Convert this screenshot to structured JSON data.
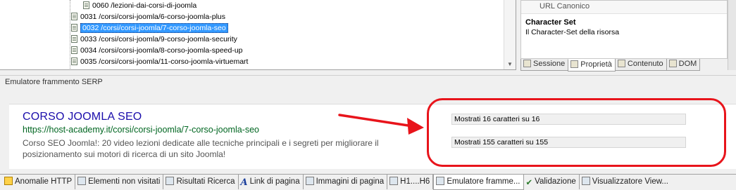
{
  "tree": {
    "rows": [
      {
        "label": "0060 /lezioni-dai-corsi-di-joomla",
        "selected": false
      },
      {
        "label": "0031 /corsi/corsi-joomla/6-corso-joomla-plus",
        "selected": false
      },
      {
        "label": "0032 /corsi/corsi-joomla/7-corso-joomla-seo",
        "selected": true
      },
      {
        "label": "0033 /corsi/corsi-joomla/9-corso-joomla-security",
        "selected": false
      },
      {
        "label": "0034 /corsi/corsi-joomla/8-corso-joomla-speed-up",
        "selected": false
      },
      {
        "label": "0035 /corsi/corsi-joomla/11-corso-joomla-virtuemart",
        "selected": false
      }
    ]
  },
  "properties": {
    "top_row": "URL Canonico",
    "title": "Character Set",
    "description": "Il Character-Set della risorsa",
    "tabs": [
      {
        "label": "Sessione",
        "active": false,
        "icon": "session-icon"
      },
      {
        "label": "Proprietà",
        "active": true,
        "icon": "properties-icon"
      },
      {
        "label": "Contenuto",
        "active": false,
        "icon": "content-icon"
      },
      {
        "label": "DOM",
        "active": false,
        "icon": "dom-icon"
      }
    ]
  },
  "serp": {
    "header": "Emulatore frammento SERP",
    "title": "CORSO JOOMLA SEO",
    "url": "https://host-academy.it/corsi/corsi-joomla/7-corso-joomla-seo",
    "description": "Corso SEO Joomla!: 20 video lezioni dedicate alle tecniche principali e i segreti per migliorare il posizionamento sui motori di ricerca di un sito Joomla!",
    "title_counter": "Mostrati 16 caratteri su 16",
    "desc_counter": "Mostrati 155 caratteri su 155"
  },
  "bottom_tabs": [
    {
      "label": "Anomalie HTTP",
      "icon": "warning-icon",
      "active": false
    },
    {
      "label": "Elementi non visitati",
      "icon": "unvisited-icon",
      "active": false
    },
    {
      "label": "Risultati Ricerca",
      "icon": "search-results-icon",
      "active": false
    },
    {
      "label": "Link di pagina",
      "icon": "link-icon",
      "active": false
    },
    {
      "label": "Immagini di pagina",
      "icon": "images-icon",
      "active": false
    },
    {
      "label": "H1....H6",
      "icon": "headings-icon",
      "active": false
    },
    {
      "label": "Emulatore framme...",
      "icon": "serp-emulator-icon",
      "active": true
    },
    {
      "label": "Validazione",
      "icon": "validation-icon",
      "active": false
    },
    {
      "label": "Visualizzatore View...",
      "icon": "viewer-icon",
      "active": false
    }
  ],
  "colors": {
    "selection": "#3399ff",
    "serp_title": "#1a0dab",
    "serp_url": "#006621",
    "annotation": "#e8141b"
  }
}
